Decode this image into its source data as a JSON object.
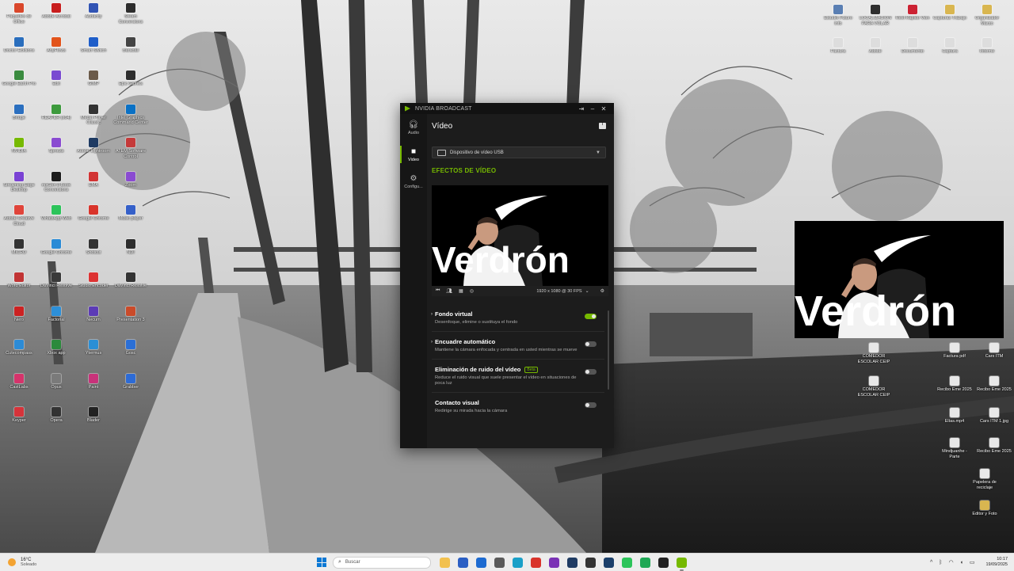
{
  "colors": {
    "accent": "#76b900",
    "window_bg": "#1c1c1c",
    "taskbar_bg": "#ededed"
  },
  "desktop": {
    "icons_left": [
      {
        "label": "Paquetes de Office",
        "color": "#d9472b"
      },
      {
        "label": "Adobe Acrobat",
        "color": "#c81e1e"
      },
      {
        "label": "Audacity",
        "color": "#3154b4"
      },
      {
        "label": "Steam Conversions",
        "color": "#2d2d2d"
      },
      {
        "label": "Doctor Ecktions",
        "color": "#2a6ebd"
      },
      {
        "label": "AnyFlows",
        "color": "#e2541b"
      },
      {
        "label": "Smart Switch",
        "color": "#1f5ec9"
      },
      {
        "label": "Baradall",
        "color": "#444"
      },
      {
        "label": "Google Earth Pro",
        "color": "#3a8b3f"
      },
      {
        "label": "Edit",
        "color": "#7a4bd1"
      },
      {
        "label": "GIMP",
        "color": "#6b5b4a"
      },
      {
        "label": "Epic Games",
        "color": "#2e2e2e"
      },
      {
        "label": "Bridge",
        "color": "#2b6fbf"
      },
      {
        "label": "REAPER (x64)",
        "color": "#3d9a3d"
      },
      {
        "label": "Media Player Classic",
        "color": "#333"
      },
      {
        "label": "Intel Graphics Command Center",
        "color": "#0a71c5"
      },
      {
        "label": "NVIDIA",
        "color": "#76b900"
      },
      {
        "label": "Sprouts",
        "color": "#8a4bd1"
      },
      {
        "label": "Adobe Lightroom",
        "color": "#1f3b63"
      },
      {
        "label": "ATEM Software Control",
        "color": "#c53a3a"
      },
      {
        "label": "Streaming Edge Desktop",
        "color": "#7a42d4"
      },
      {
        "label": "mxGen 8 Book Conversions",
        "color": "#1d1d1d"
      },
      {
        "label": "EMA",
        "color": "#d23434"
      },
      {
        "label": "Zoom",
        "color": "#8a4bd1"
      },
      {
        "label": "Adobe Creative Cloud",
        "color": "#e0443a"
      },
      {
        "label": "WhatsApp Web",
        "color": "#2cc45a"
      },
      {
        "label": "Google Chrome",
        "color": "#d9342b"
      },
      {
        "label": "Music player",
        "color": "#3560c9"
      },
      {
        "label": "MICRO",
        "color": "#333"
      },
      {
        "label": "Google Chrome",
        "color": "#2a8bd6"
      },
      {
        "label": "Shotcut",
        "color": "#333"
      },
      {
        "label": "NDI",
        "color": "#2d2d2d"
      },
      {
        "label": "Word Editor",
        "color": "#c13434"
      },
      {
        "label": "DaVinci Resolve",
        "color": "#3a3a3a"
      },
      {
        "label": "Studio Encoder",
        "color": "#d33"
      },
      {
        "label": "DaVinci Resolve",
        "color": "#333"
      },
      {
        "label": "Nero",
        "color": "#c22"
      },
      {
        "label": "Factorial",
        "color": "#2c8fd8"
      },
      {
        "label": "Necum",
        "color": "#5c3bb6"
      },
      {
        "label": "Presentation 3",
        "color": "#ca4b2a"
      },
      {
        "label": "Cutecompass",
        "color": "#2c8bd6"
      },
      {
        "label": "Xbox app",
        "color": "#2c8a3c"
      },
      {
        "label": "Ytermus",
        "color": "#2b8fd6"
      },
      {
        "label": "Gosc",
        "color": "#2b6fd6"
      },
      {
        "label": "CastLabs",
        "color": "#d6336b"
      },
      {
        "label": "Opus",
        "color": "#7a7a7a"
      },
      {
        "label": "Paint",
        "color": "#c8327a"
      },
      {
        "label": "Grabber",
        "color": "#2d6bd6"
      },
      {
        "label": "Keyper",
        "color": "#d6333a"
      },
      {
        "label": "Opera",
        "color": "#333"
      },
      {
        "label": "Blader",
        "color": "#222"
      }
    ],
    "icons_right": [
      {
        "label": "Estudio Futuro Info",
        "color": "#5a7fb3"
      },
      {
        "label": "LOCALIZACIÓN PARA VOLAR",
        "color": "#2f2f2f"
      },
      {
        "label": "Reel Rápido Vion",
        "color": "#c23"
      },
      {
        "label": "Capturas Trabajo",
        "color": "#d9b650"
      },
      {
        "label": "Organizador Marzo",
        "color": "#d9b650"
      },
      {
        "label": "Factura",
        "color": "#ddd"
      },
      {
        "label": "Adobe",
        "color": "#ddd"
      },
      {
        "label": "Documento",
        "color": "#ddd"
      },
      {
        "label": "Captura",
        "color": "#ddd"
      },
      {
        "label": "Informe",
        "color": "#ddd"
      }
    ],
    "file_icons_bottom_right": [
      {
        "label": "COMEDOR ESCOLAR CEIP",
        "color": "#e8e8e8"
      },
      {
        "label": "Factura pdf",
        "color": "#e8e8e8"
      },
      {
        "label": "Cars ITM",
        "color": "#e8e8e8"
      },
      {
        "label": "COMEDOR ESCOLAR CEIP",
        "color": "#e8e8e8"
      },
      {
        "label": "Recibo Eme 2025",
        "color": "#e8e8e8"
      },
      {
        "label": "Recibo Eme 2025",
        "color": "#e8e8e8"
      },
      {
        "label": "Elías.mp4",
        "color": "#e8e8e8"
      },
      {
        "label": "Cars ITM 1.jpg",
        "color": "#e8e8e8"
      },
      {
        "label": "Mindjuanhe - Parte",
        "color": "#e8e8e8"
      },
      {
        "label": "Recibo Eme 2025",
        "color": "#e8e8e8"
      },
      {
        "label": "Papelera de reciclaje",
        "color": "#e8e8e8"
      },
      {
        "label": "Editor y Foto",
        "color": "#d9b650"
      }
    ]
  },
  "nvidia": {
    "window_title": "NVIDIA BROADCAST",
    "nav": [
      {
        "label": "Audio",
        "icon": "headphones-icon"
      },
      {
        "label": "Video",
        "icon": "camera-icon"
      },
      {
        "label": "Configu...",
        "icon": "gear-icon"
      }
    ],
    "page_title": "Vídeo",
    "device": "Dispositivo de vídeo USB",
    "effects_title": "EFECTOS DE VÍDEO",
    "preview_overlay_text": "Verdrón",
    "resolution": "1920 x 1080 @ 30 FPS",
    "effects": [
      {
        "name": "Fondo virtual",
        "desc": "Desenfoque, elimine o sustituya el fondo",
        "enabled": true
      },
      {
        "name": "Encuadre automático",
        "desc": "Mantiene la cámara enfocada y centrada en usted mientras se mueve",
        "enabled": false
      },
      {
        "name": "Eliminación de ruido del vídeo",
        "badge": "Beta",
        "desc": "Reduce el ruido visual que suele presentar el vídeo en situaciones de poca luz",
        "enabled": false
      },
      {
        "name": "Contacto visual",
        "desc": "Redirige su mirada hacia la cámara",
        "enabled": false
      }
    ]
  },
  "camera_float": {
    "overlay_text": "Verdrón"
  },
  "taskbar": {
    "weather_temp": "16°C",
    "weather_desc": "Soleado",
    "search_placeholder": "Buscar",
    "time": "10:17",
    "date": "19/09/2025",
    "apps": [
      {
        "name": "file-explorer",
        "color": "#f2c14e"
      },
      {
        "name": "store",
        "color": "#2b5fc4"
      },
      {
        "name": "outlook",
        "color": "#1d6bd1"
      },
      {
        "name": "calculator",
        "color": "#5a5a5a"
      },
      {
        "name": "edge",
        "color": "#1aa0c8"
      },
      {
        "name": "chrome",
        "color": "#d9342b"
      },
      {
        "name": "onenote",
        "color": "#7a32b5"
      },
      {
        "name": "lightroom",
        "color": "#1f3b63"
      },
      {
        "name": "terminal",
        "color": "#333"
      },
      {
        "name": "photoshop",
        "color": "#1b3f6a"
      },
      {
        "name": "whatsapp",
        "color": "#2cc45a"
      },
      {
        "name": "whatsapp-business",
        "color": "#1fa855"
      },
      {
        "name": "obs",
        "color": "#222"
      },
      {
        "name": "nvidia-broadcast",
        "color": "#76b900"
      }
    ]
  }
}
